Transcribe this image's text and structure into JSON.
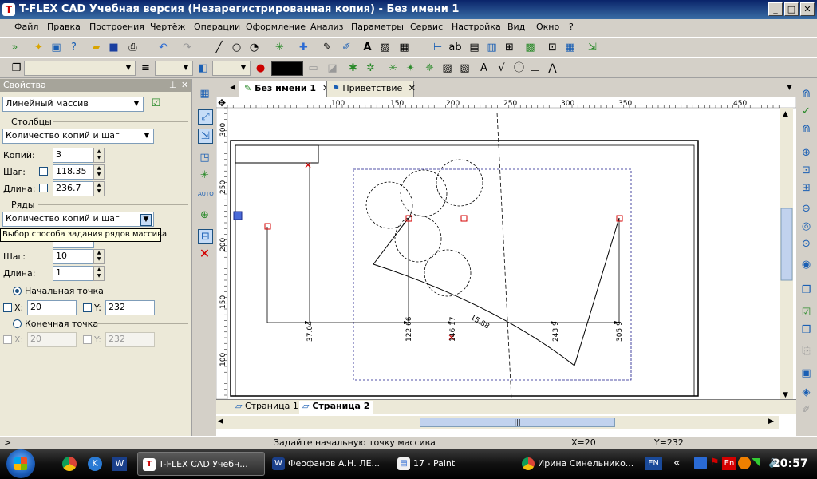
{
  "window": {
    "title": "T-FLEX CAD Учебная версия (Незарегистрированная копия) - Без имени 1",
    "icon": "tflex-app-icon"
  },
  "menu": [
    "Файл",
    "Правка",
    "Построения",
    "Чертёж",
    "Операции",
    "Оформление",
    "Анализ",
    "Параметры",
    "Сервис",
    "Настройка",
    "Вид",
    "Окно",
    "?"
  ],
  "toolbar2": {
    "color": "#000000"
  },
  "properties": {
    "header": "Свойства",
    "operation": "Линейный массив",
    "columns_group": "Столбцы",
    "columns_mode": "Количество копий и шаг",
    "copies_label": "Копий:",
    "copies_value": "3",
    "step_label": "Шаг:",
    "step_value": "118.35",
    "length_label": "Длина:",
    "length_value": "236.7",
    "rows_group": "Ряды",
    "rows_mode": "Количество копий и шаг",
    "tooltip": "Выбор способа задания рядов массива",
    "rows_step_label": "Шаг:",
    "rows_step_value": "10",
    "rows_length_label": "Длина:",
    "rows_length_value": "1",
    "start_point": "Начальная точка",
    "start_x_label": "X:",
    "start_x": "20",
    "start_y_label": "Y:",
    "start_y": "232",
    "end_point": "Конечная точка",
    "end_x_label": "X:",
    "end_x": "20",
    "end_y_label": "Y:",
    "end_y": "232"
  },
  "tabs": [
    {
      "label": "Без имени 1",
      "active": true
    },
    {
      "label": "Приветствие",
      "active": false
    }
  ],
  "ruler": {
    "top": [
      "100",
      "150",
      "200",
      "250",
      "300",
      "350",
      "450"
    ],
    "left": [
      "300",
      "250",
      "200",
      "150",
      "100"
    ]
  },
  "drawing": {
    "dims": [
      "37.04",
      "122.66",
      "146.17",
      "243.9",
      "305.9"
    ],
    "angle": "15.88"
  },
  "pages": [
    {
      "label": "Страница 1",
      "active": false
    },
    {
      "label": "Страница 2",
      "active": true
    }
  ],
  "status": {
    "prompt": ">",
    "message": "Задайте начальную точку массива",
    "x": "X=20",
    "y": "Y=232"
  },
  "taskbar": {
    "buttons": [
      {
        "label": "T-FLEX CAD Учебн...",
        "active": true,
        "icon": "tflex-icon"
      },
      {
        "label": "Феофанов А.Н. ЛЕ...",
        "active": false,
        "icon": "word-icon"
      },
      {
        "label": "17 - Paint",
        "active": false,
        "icon": "paint-icon"
      },
      {
        "label": "Ирина Синельнико...",
        "active": false,
        "icon": "chrome-icon"
      }
    ],
    "lang": "EN",
    "tray_lang": "En",
    "clock": "20:57"
  }
}
